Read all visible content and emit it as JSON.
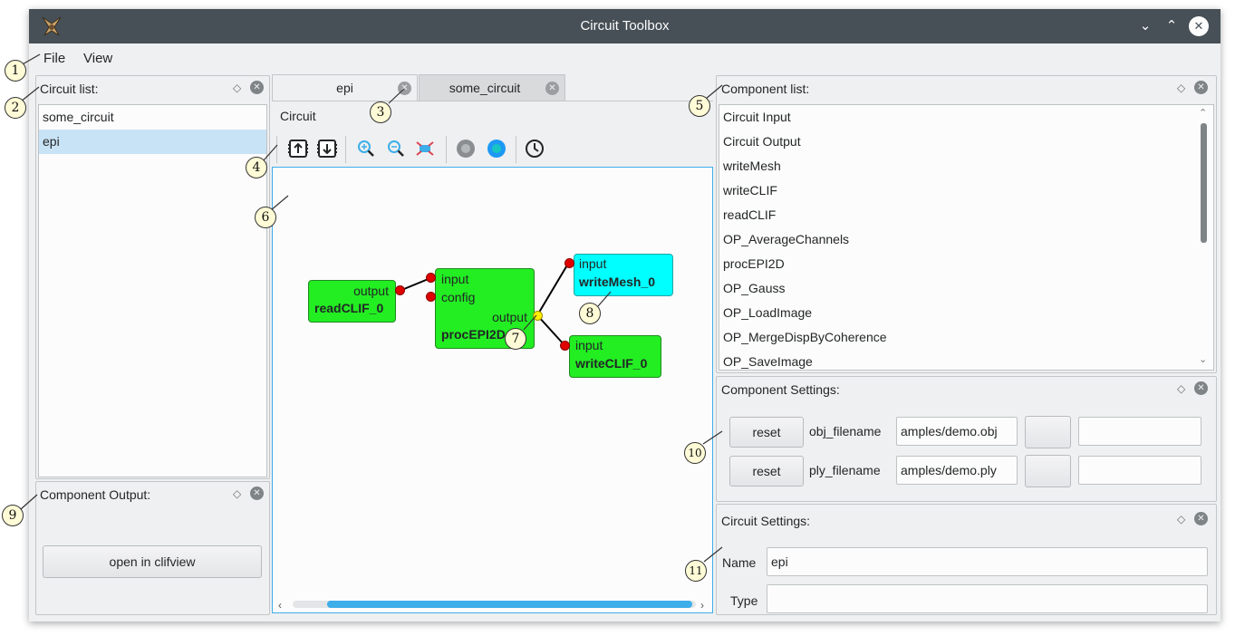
{
  "window": {
    "title": "Circuit Toolbox"
  },
  "titlebar_icons": {
    "minimize": "chevron-down-icon",
    "maximize": "chevron-up-icon",
    "close": "close-icon"
  },
  "menu": {
    "file": "File",
    "view": "View"
  },
  "circuit_list": {
    "title": "Circuit list:",
    "items": [
      {
        "label": "some_circuit"
      },
      {
        "label": "epi",
        "selected": true
      }
    ]
  },
  "component_output": {
    "title": "Component Output:",
    "button": "open in clifview"
  },
  "tabs": [
    {
      "label": "epi",
      "active": true
    },
    {
      "label": "some_circuit",
      "active": false
    }
  ],
  "circuit_header": "Circuit",
  "toolbar_icons": [
    "import-icon",
    "export-icon",
    "zoom-in-icon",
    "zoom-out-icon",
    "fit-icon",
    "stop-icon",
    "run-icon",
    "clock-icon"
  ],
  "graph": {
    "nodes": [
      {
        "id": "readCLIF_0",
        "ports": [
          "output"
        ],
        "color": "#22ee22"
      },
      {
        "id": "procEPI2D",
        "ports": [
          "input",
          "config",
          "output"
        ],
        "color": "#22ee22"
      },
      {
        "id": "writeMesh_0",
        "ports": [
          "input"
        ],
        "color": "#00ffff"
      },
      {
        "id": "writeCLIF_0",
        "ports": [
          "input"
        ],
        "color": "#22ee22"
      }
    ]
  },
  "component_list": {
    "title": "Component list:",
    "items": [
      "Circuit Input",
      "Circuit Output",
      "writeMesh",
      "writeCLIF",
      "readCLIF",
      "OP_AverageChannels",
      "procEPI2D",
      "OP_Gauss",
      "OP_LoadImage",
      "OP_MergeDispByCoherence",
      "OP_SaveImage"
    ]
  },
  "component_settings": {
    "title": "Component Settings:",
    "rows": [
      {
        "reset": "reset",
        "label": "obj_filename",
        "value": "amples/demo.obj"
      },
      {
        "reset": "reset",
        "label": "ply_filename",
        "value": "amples/demo.ply"
      }
    ]
  },
  "circuit_settings": {
    "title": "Circuit Settings:",
    "name_label": "Name",
    "name_value": "epi",
    "type_label": "Type",
    "type_value": ""
  },
  "callouts": [
    "1",
    "2",
    "3",
    "4",
    "5",
    "6",
    "7",
    "8",
    "9",
    "10",
    "11"
  ],
  "colors": {
    "accent": "#3daee9",
    "titlebar": "#475057",
    "node_green": "#22ee22",
    "node_cyan": "#00ffff",
    "port_red": "#e00000",
    "port_yellow": "#ffee00"
  }
}
